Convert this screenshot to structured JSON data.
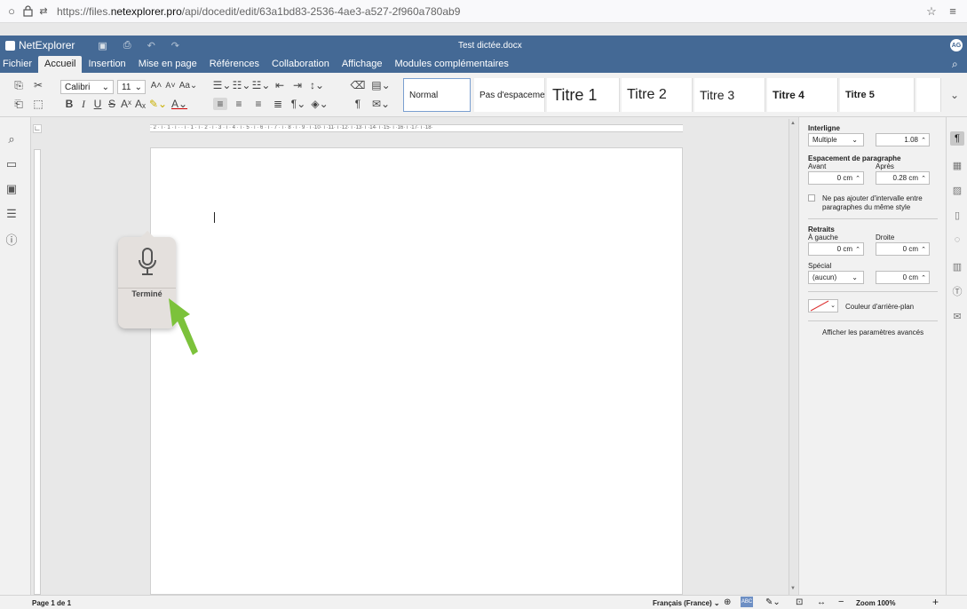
{
  "browser": {
    "url_prefix": "https://files.",
    "url_domain": "netexplorer.pro",
    "url_suffix": "/api/docedit/edit/63a1bd83-2536-4ae3-a527-2f960a780ab9"
  },
  "app": {
    "name": "NetExplorer",
    "doc_title": "Test dictée.docx",
    "avatar": "AG"
  },
  "menu": [
    "Fichier",
    "Accueil",
    "Insertion",
    "Mise en page",
    "Références",
    "Collaboration",
    "Affichage",
    "Modules complémentaires"
  ],
  "toolbar": {
    "font": "Calibri",
    "size": "11"
  },
  "styles": [
    "Normal",
    "Pas d'espaceme",
    "Titre 1",
    "Titre 2",
    "Titre 3",
    "Titre 4",
    "Titre 5"
  ],
  "ruler_h": "· 2 · ı · 1 · ı ·   · ı · 1 · ı · 2 · ı · 3 · ı · 4 · ı · 5 · ı · 6 · ı · 7 · ı · 8 · ı · 9 · ı ·10· ı ·11· ı ·12· ı ·13· ı ·14· ı ·15· ı ·16· ı ·17· ı ·18·",
  "dictation": {
    "label": "Terminé"
  },
  "panel": {
    "interligne": "Interligne",
    "interligne_mode": "Multiple",
    "interligne_value": "1.08",
    "espacement": "Espacement de paragraphe",
    "avant": "Avant",
    "apres": "Après",
    "avant_value": "0 cm",
    "apres_value": "0.28 cm",
    "checkbox_label_1": "Ne pas ajouter d'intervalle entre",
    "checkbox_label_2": "paragraphes du même style",
    "retraits": "Retraits",
    "gauche": "À gauche",
    "droite": "Droite",
    "gauche_value": "0 cm",
    "droite_value": "0 cm",
    "special": "Spécial",
    "special_mode": "(aucun)",
    "special_value": "0 cm",
    "bg_color": "Couleur d'arrière-plan",
    "advanced": "Afficher les paramètres avancés"
  },
  "status": {
    "page": "Page 1 de 1",
    "language": "Français (France)",
    "zoom": "Zoom 100%"
  }
}
